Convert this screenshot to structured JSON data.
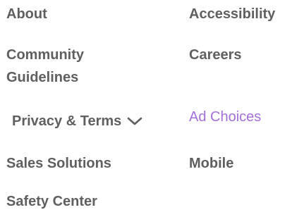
{
  "footer": {
    "links": {
      "about": "About",
      "accessibility": "Accessibility",
      "community_guidelines": "Community Guidelines",
      "careers": "Careers",
      "privacy_terms": "Privacy & Terms",
      "ad_choices": "Ad Choices",
      "sales_solutions": "Sales Solutions",
      "mobile": "Mobile",
      "safety_center": "Safety Center"
    },
    "colors": {
      "text": "#5f5f5f",
      "accent_link": "#a56fdb"
    },
    "icons": {
      "privacy_dropdown": "chevron-down-icon"
    }
  }
}
